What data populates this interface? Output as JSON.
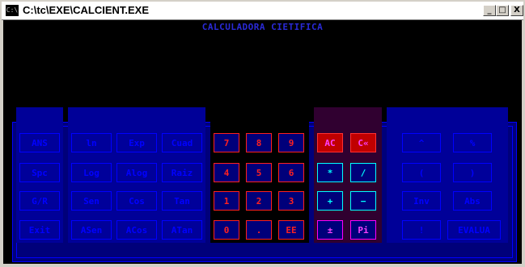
{
  "window": {
    "title": "C:\\tc\\EXE\\CALCIENT.EXE",
    "icon_label": "C:\\",
    "minimize": "_",
    "maximize": "□",
    "close": "X"
  },
  "calc": {
    "title": "CALCULADORA CIETIFICA"
  },
  "functions_left": [
    "ANS",
    "Spc",
    "G/R",
    "Exit"
  ],
  "functions_mid": [
    [
      "ln",
      "Exp",
      "Cuad"
    ],
    [
      "Log",
      "Alog",
      "Raiz"
    ],
    [
      "Sen",
      "Cos",
      "Tan"
    ],
    [
      "ASen",
      "ACos",
      "ATan"
    ]
  ],
  "digits": [
    [
      "7",
      "8",
      "9"
    ],
    [
      "4",
      "5",
      "6"
    ],
    [
      "1",
      "2",
      "3"
    ],
    [
      "0",
      ".",
      "EE"
    ]
  ],
  "operators": [
    [
      "AC",
      "C«"
    ],
    [
      "*",
      "/"
    ],
    [
      "+",
      "−"
    ],
    [
      "±",
      "Pi"
    ]
  ],
  "right_keys": [
    [
      "^",
      "%"
    ],
    [
      "(",
      ")"
    ],
    [
      "Inv",
      "Abs"
    ],
    [
      "!",
      "EVALUA"
    ]
  ],
  "colors": {
    "panel": "#000098",
    "blue_key": "#0000ff",
    "red_key": "#ff2020",
    "cyan_key": "#00ffff",
    "magenta_key": "#ff00ff"
  }
}
